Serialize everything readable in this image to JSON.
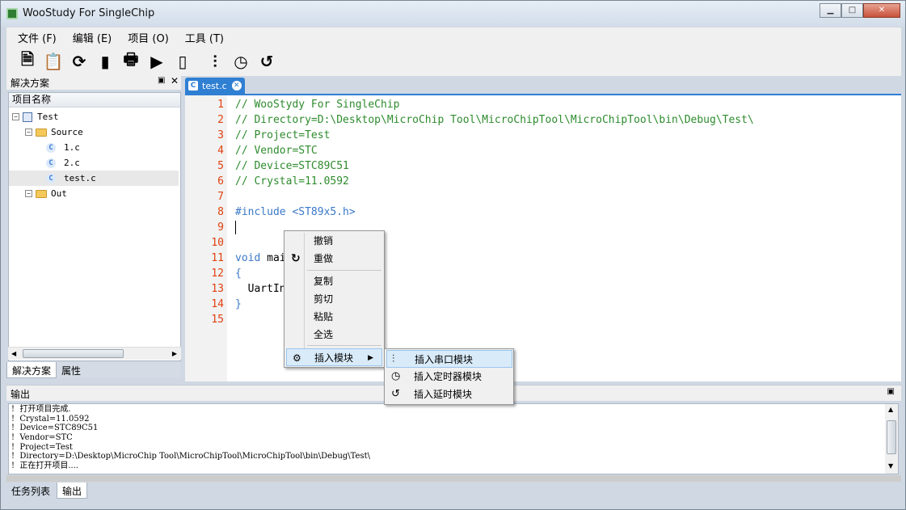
{
  "window": {
    "title": "WooStudy For SingleChip",
    "min_label": "▁",
    "max_label": "□",
    "close_label": "✕"
  },
  "menu": [
    {
      "label": "文件 (F)"
    },
    {
      "label": "编辑 (E)"
    },
    {
      "label": "项目 (O)"
    },
    {
      "label": "工具 (T)"
    }
  ],
  "toolbar": {
    "icons": [
      "new-file-icon",
      "checklist-icon",
      "refresh-icon",
      "sd-card-icon",
      "print-icon",
      "play-icon",
      "chip-icon",
      "serial-port-icon",
      "clock-icon",
      "history-icon"
    ],
    "glyphs": [
      "🗎",
      "📋",
      "⟳",
      "▮",
      "🖶",
      "▶",
      "▯",
      "⫶",
      "◷",
      "↺"
    ]
  },
  "solution": {
    "title": "解决方案",
    "pin": "▣",
    "close": "✕",
    "header": "项目名称",
    "nodes": [
      {
        "label": "Test",
        "exp": "−"
      },
      {
        "label": "Source",
        "exp": "−"
      },
      {
        "label": "1.c"
      },
      {
        "label": "2.c"
      },
      {
        "label": "test.c"
      },
      {
        "label": "Out",
        "exp": "−"
      }
    ],
    "tabs": [
      "解决方案",
      "属性"
    ]
  },
  "editor": {
    "tab_label": "test.c",
    "tab_icon": "C",
    "tab_close": "✕",
    "line_numbers": [
      "1",
      "2",
      "3",
      "4",
      "5",
      "6",
      "7",
      "8",
      "9",
      "10",
      "11",
      "12",
      "13",
      "14",
      "15"
    ],
    "lines": {
      "l1": "// WooStydy For SingleChip",
      "l2": "// Directory=D:\\Desktop\\MicroChip Tool\\MicroChipTool\\MicroChipTool\\bin\\Debug\\Test\\",
      "l3": "// Project=Test",
      "l4": "// Vendor=STC",
      "l5": "// Device=STC89C51",
      "l6": "// Crystal=11.0592",
      "l8": "#include <ST89x5.h>",
      "l11_kw": "void",
      "l11_rest": " mai",
      "l12": "{",
      "l13": "  UartIn",
      "l14": "}"
    }
  },
  "context_menu": {
    "undo": "撤销",
    "redo": "重做",
    "copy": "复制",
    "cut": "剪切",
    "paste": "粘贴",
    "select_all": "全选",
    "insert_module": "插入模块",
    "redo_icon": "↻",
    "insert_icon": "⚙",
    "arrow": "▶"
  },
  "submenu": {
    "serial": "插入串口模块",
    "timer": "插入定时器模块",
    "delay": "插入延时模块",
    "serial_icon": "⫶",
    "timer_icon": "◷",
    "delay_icon": "↺"
  },
  "output": {
    "title": "输出",
    "pin": "▣",
    "lines": [
      "!  打开项目完成.",
      "!  Crystal=11.0592",
      "!  Device=STC89C51",
      "!  Vendor=STC",
      "!  Project=Test",
      "!  Directory=D:\\Desktop\\MicroChip Tool\\MicroChipTool\\MicroChipTool\\bin\\Debug\\Test\\",
      "!  正在打开项目...."
    ],
    "tabs": [
      "任务列表",
      "输出"
    ]
  }
}
